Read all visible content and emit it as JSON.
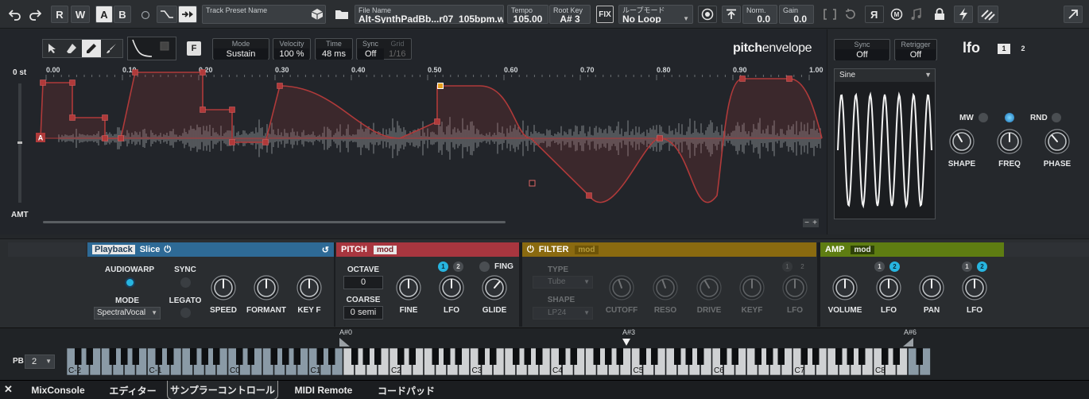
{
  "toolbar": {
    "undo_icon": "undo-icon",
    "redo_icon": "redo-icon",
    "read_label": "R",
    "write_label": "W",
    "a_label": "A",
    "b_label": "B",
    "track_preset_label": "Track Preset Name",
    "file_name_label": "File Name",
    "file_name_value": "Alt-SynthPadBb...r07_105bpm.wav",
    "tempo_label": "Tempo",
    "tempo_value": "105.00",
    "root_key_label": "Root Key",
    "root_key_value": "A# 3",
    "fix_label": "FIX",
    "loop_mode_label": "ループモード",
    "loop_mode_value": "No Loop",
    "norm_label": "Norm.",
    "norm_value": "0.0",
    "gain_label": "Gain",
    "gain_value": "0.0",
    "reverse_label": "R"
  },
  "editor": {
    "mode_label": "Mode",
    "mode_value": "Sustain",
    "velocity_label": "Velocity",
    "velocity_value": "100 %",
    "time_label": "Time",
    "time_value": "48 ms",
    "sync_label": "Sync",
    "sync_value": "Off",
    "grid_label": "Grid",
    "grid_value": "1/16",
    "f_label": "F",
    "brand_bold": "pitch",
    "brand_light": "envelope",
    "st_label": "0 st",
    "amt_label": "AMT",
    "marker_a": "A",
    "ruler": [
      "0.00",
      "0.10",
      "0.20",
      "0.30",
      "0.40",
      "0.50",
      "0.60",
      "0.70",
      "0.80",
      "0.90",
      "1.00"
    ],
    "minus": "−",
    "plus": "+"
  },
  "lfo": {
    "sync_label": "Sync",
    "sync_value": "Off",
    "retrigger_label": "Retrigger",
    "retrigger_value": "Off",
    "title": "lfo",
    "tab1": "1",
    "tab2": "2",
    "waveform": "Sine",
    "mw_label": "MW",
    "rnd_label": "RND",
    "knobs": [
      "SHAPE",
      "FREQ",
      "PHASE"
    ]
  },
  "playback": {
    "tab_playback": "Playback",
    "tab_slice": "Slice",
    "audiowarp_label": "AUDIOWARP",
    "sync_label": "SYNC",
    "mode_label": "MODE",
    "legato_label": "LEGATO",
    "mode_value": "SpectralVocal",
    "knobs": [
      "SPEED",
      "FORMANT",
      "KEY F"
    ]
  },
  "pitch": {
    "title": "PITCH",
    "mod": "mod",
    "octave_label": "OCTAVE",
    "octave_value": "0",
    "coarse_label": "COARSE",
    "coarse_value": "0 semi",
    "fing_label": "FING",
    "lfo1": "1",
    "lfo2": "2",
    "knobs": [
      "FINE",
      "LFO",
      "GLIDE"
    ]
  },
  "filter": {
    "title": "FILTER",
    "mod": "mod",
    "type_label": "TYPE",
    "type_value": "Tube",
    "shape_label": "SHAPE",
    "shape_value": "LP24",
    "lfo1": "1",
    "lfo2": "2",
    "knobs": [
      "CUTOFF",
      "RESO",
      "DRIVE",
      "KEYF",
      "LFO"
    ]
  },
  "amp": {
    "title": "AMP",
    "mod": "mod",
    "lfo1a": "1",
    "lfo2a": "2",
    "lfo1b": "1",
    "lfo2b": "2",
    "knobs": [
      "VOLUME",
      "LFO",
      "PAN",
      "LFO"
    ]
  },
  "keyboard": {
    "pb_label": "PB",
    "pb_value": "2",
    "range_low": "A#0",
    "root": "A#3",
    "range_high": "A#6",
    "octaves": [
      "C-2",
      "C-1",
      "C0",
      "C1",
      "C2",
      "C3",
      "C4",
      "C5",
      "C6",
      "C7",
      "C8"
    ]
  },
  "tabs": [
    "MixConsole",
    "エディター",
    "サンプラーコントロール",
    "MIDI Remote",
    "コードパッド"
  ],
  "active_tab": 2,
  "colors": {
    "playback": "#2e6a96",
    "pitch": "#a8363f",
    "filter": "#8a6a10",
    "amp": "#5e7d12",
    "envelope": "#b03a3a",
    "accent": "#27b5e0"
  }
}
